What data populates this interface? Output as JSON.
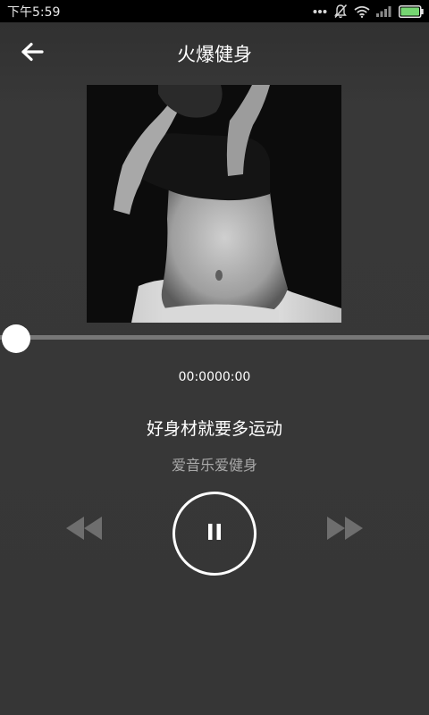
{
  "status_bar": {
    "time": "下午5:59",
    "icons": [
      "more-dots-icon",
      "notifications-muted-icon",
      "wifi-icon",
      "signal-icon",
      "battery-icon"
    ],
    "battery_color": "#76d672"
  },
  "header": {
    "title": "火爆健身",
    "back_icon": "back-arrow-icon"
  },
  "player": {
    "time_display": "00:0000:00",
    "progress": 0,
    "song_title": "好身材就要多运动",
    "song_subtitle": "爱音乐爱健身",
    "controls": {
      "prev_icon": "rewind-icon",
      "play_icon": "pause-icon",
      "next_icon": "fast-forward-icon"
    }
  },
  "colors": {
    "background": "#363636",
    "track": "#777777",
    "muted_control": "#6e6e6e",
    "subtitle": "#a9a9a9"
  }
}
